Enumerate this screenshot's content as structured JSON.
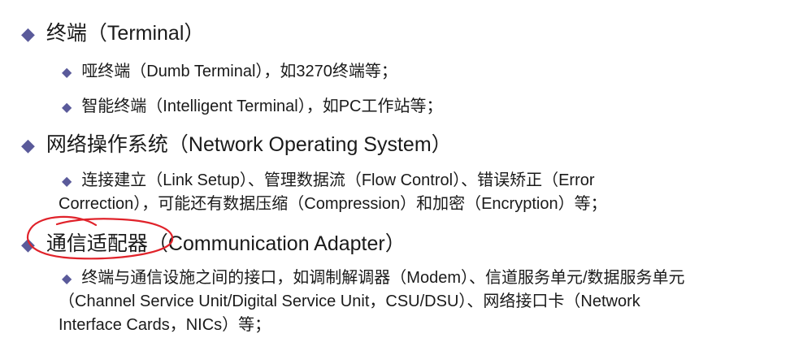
{
  "sections": [
    {
      "heading": "终端（Terminal）",
      "items": [
        "哑终端（Dumb Terminal），如3270终端等；",
        "智能终端（Intelligent Terminal），如PC工作站等；"
      ]
    },
    {
      "heading": "网络操作系统（Network Operating System）",
      "items": [
        [
          "连接建立（Link Setup）、管理数据流（Flow Control）、错误矫正（Error",
          "Correction），可能还有数据压缩（Compression）和加密（Encryption）等；"
        ]
      ]
    },
    {
      "heading": "通信适配器（Communication Adapter）",
      "items": [
        [
          "终端与通信设施之间的接口，如调制解调器（Modem）、信道服务单元/数据服务单元",
          "（Channel Service Unit/Digital Service Unit，CSU/DSU）、网络接口卡（Network",
          "Interface Cards，NICs）等；"
        ]
      ]
    }
  ],
  "bullet_icon": "diamond-bullet-icon",
  "colors": {
    "bullet": "#5a5a9a",
    "text": "#1a1a1a",
    "annotation": "#e0222a"
  }
}
